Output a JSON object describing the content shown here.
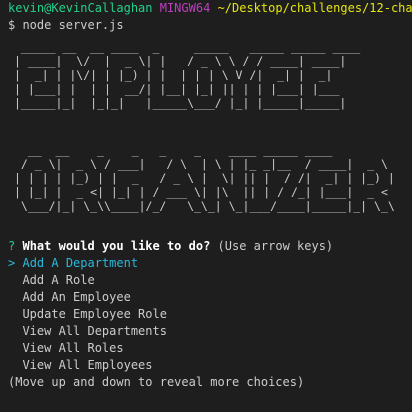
{
  "prompt": {
    "user": "kevin@KevinCallaghan",
    "host": "MINGW64",
    "path": "~/Desktop/challenges/12-chall",
    "command": "$ node server.js"
  },
  "banner": {
    "line1": " _____ __  __ ____  _     _____   _____ _____ ____\n| ____|  \\/  |  _ \\| |   / _ \\ \\ / / ____| ____|\n|  _| | |\\/| | |_) | |  | | | \\ V /|  _| |  _|\n| |___| |  | |  __/| |__| |_| || | | |___| |___\n|_____|_|  |_|_|   |_____\\___/ |_| |_____|_____|",
    "line2": "  __  __    _    _   _    _    ____ _____ ____\n / _ \\|  _ \\ / ___|   / \\  | \\ | |_ _|__  / ____|  _ \\\n| | | | |_) | |  _   / _ \\ |  \\| || |  / /|  _| | |_) |\n| |_| |  _ <| |_| | / ___ \\| |\\  || | / /_| |___|  _ <\n \\___/|_| \\_\\\\____|/_/   \\_\\_| \\_|___/____|_____|_| \\_\\"
  },
  "question": {
    "mark": "?",
    "text": "What would you like to do?",
    "hint": "(Use arrow keys)"
  },
  "choices": {
    "pointer": ">",
    "selected": "Add A Department",
    "items": [
      "Add A Role",
      "Add An Employee",
      "Update Employee Role",
      "View All Departments",
      "View All Roles",
      "View All Employees"
    ]
  },
  "footer": "(Move up and down to reveal more choices)",
  "colors": {
    "background": "#1e1e1e",
    "user": "#23d18b",
    "host": "#bc3fbc",
    "path": "#e5e510",
    "selected": "#29b8db"
  }
}
